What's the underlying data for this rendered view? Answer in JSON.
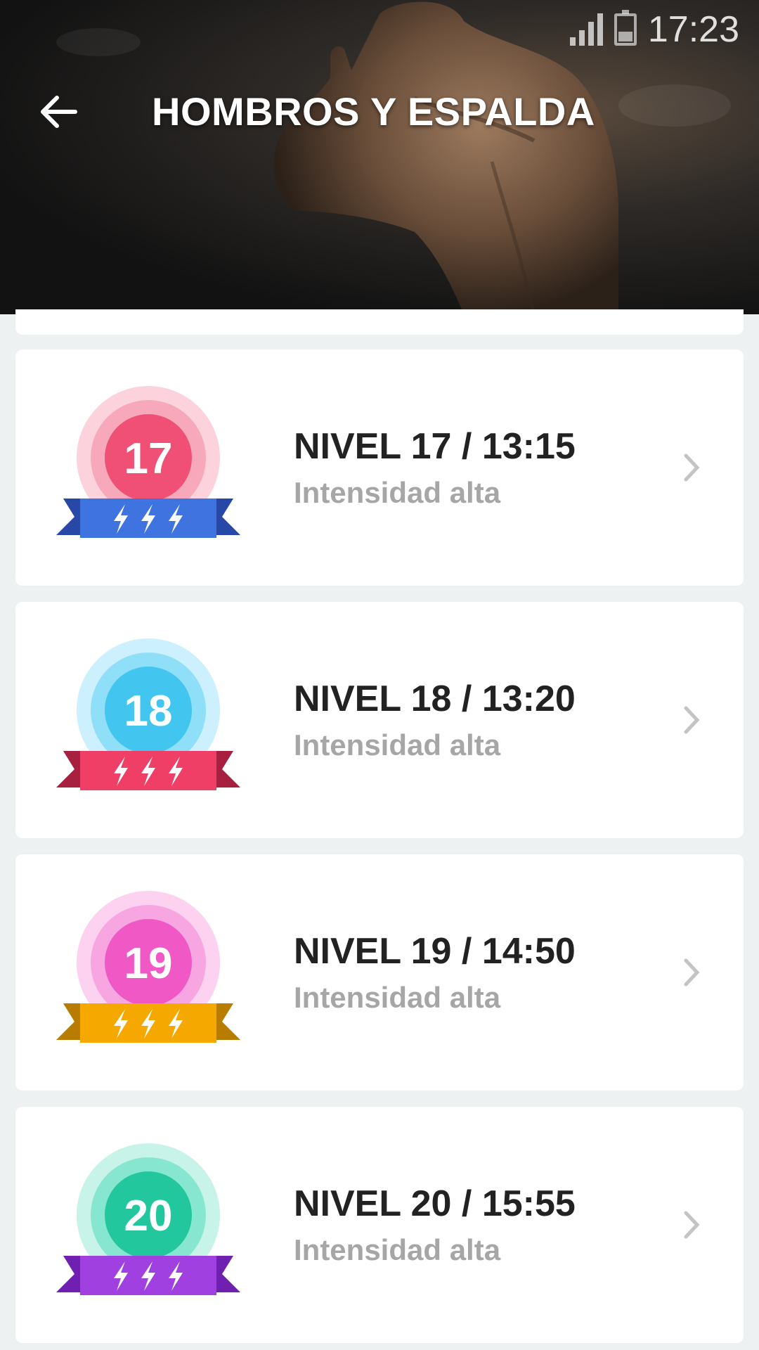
{
  "status_bar": {
    "time": "17:23"
  },
  "header": {
    "title": "HOMBROS Y ESPALDA",
    "back_icon": "arrow-back-icon"
  },
  "levels": [
    {
      "number": "17",
      "title": "NIVEL 17 / 13:15",
      "subtitle": "Intensidad alta",
      "colors": {
        "outer": "#fcd3dd",
        "mid": "#f7a8bb",
        "inner": "#f04f76",
        "ribbon": "#3f74e0",
        "ribbon_dark": "#2848a8"
      }
    },
    {
      "number": "18",
      "title": "NIVEL 18 / 13:20",
      "subtitle": "Intensidad alta",
      "colors": {
        "outer": "#ccf0fd",
        "mid": "#8fdff8",
        "inner": "#42c6f0",
        "ribbon": "#ef3f66",
        "ribbon_dark": "#a8203f"
      }
    },
    {
      "number": "19",
      "title": "NIVEL 19 / 14:50",
      "subtitle": "Intensidad alta",
      "colors": {
        "outer": "#fcd2f0",
        "mid": "#f8a6e2",
        "inner": "#f058c6",
        "ribbon": "#f5a800",
        "ribbon_dark": "#b87c00"
      }
    },
    {
      "number": "20",
      "title": "NIVEL 20 / 15:55",
      "subtitle": "Intensidad alta",
      "colors": {
        "outer": "#c8f3e8",
        "mid": "#86e6cf",
        "inner": "#22c79e",
        "ribbon": "#a040e0",
        "ribbon_dark": "#7020b0"
      }
    }
  ]
}
